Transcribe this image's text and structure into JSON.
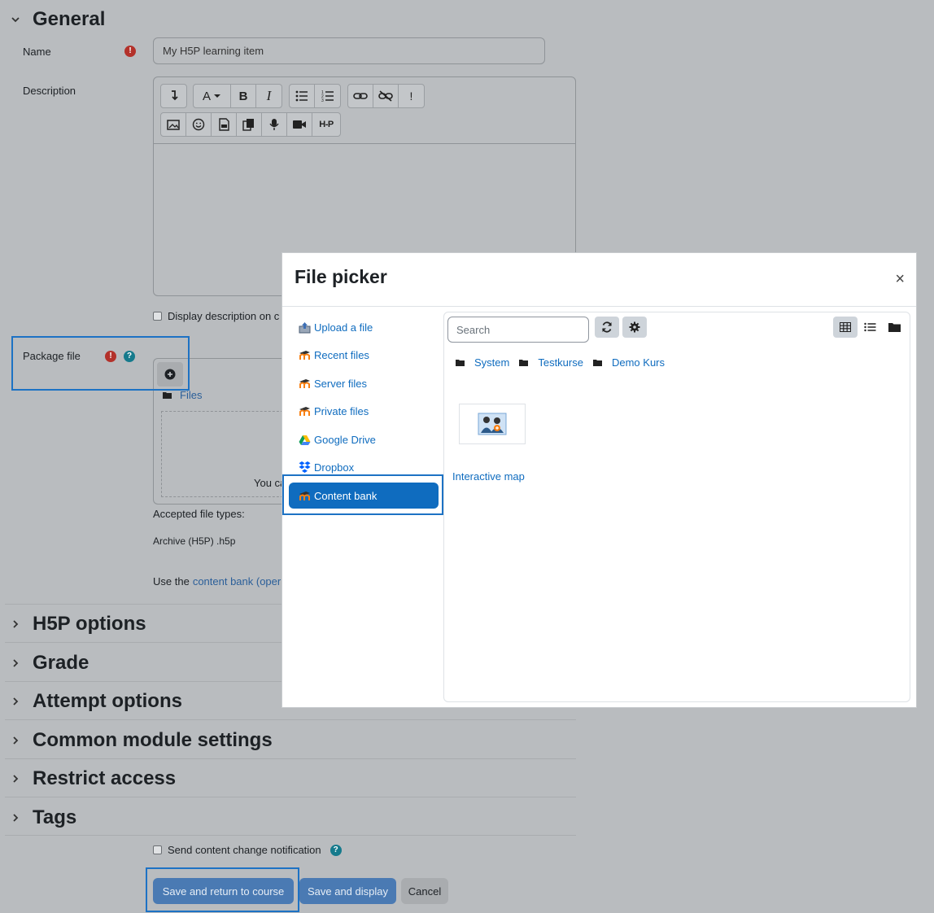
{
  "general": {
    "title": "General",
    "name_label": "Name",
    "name_value": "My H5P learning item",
    "description_label": "Description",
    "display_description_label": "Display description on c",
    "package_file_label": "Package file",
    "files_label": "Files",
    "drop_text_partial": "You ca",
    "accepted_types_label": "Accepted file types:",
    "accepted_type": "Archive (H5P) .h5p",
    "use_the": "Use the",
    "content_bank_link": "content bank (oper"
  },
  "editor_toolbar": {
    "row1": [
      "collapse-icon",
      "font-color-icon",
      "bold-icon",
      "italic-icon",
      "unordered-list-icon",
      "ordered-list-icon",
      "link-icon",
      "unlink-icon",
      "emoji-alert-icon"
    ],
    "row2": [
      "image-icon",
      "emoji-icon",
      "media-icon",
      "copy-icon",
      "microphone-icon",
      "video-icon",
      "h5p-icon"
    ],
    "h5p_label": "H-P",
    "font_label": "A",
    "bold_label": "B",
    "italic_label": "I",
    "exclaim_label": "!"
  },
  "sections": [
    {
      "title": "H5P options"
    },
    {
      "title": "Grade"
    },
    {
      "title": "Attempt options"
    },
    {
      "title": "Common module settings"
    },
    {
      "title": "Restrict access"
    },
    {
      "title": "Tags"
    }
  ],
  "footer": {
    "notify_label": "Send content change notification",
    "save_return_label": "Save and return to course",
    "save_display_label": "Save and display",
    "cancel_label": "Cancel"
  },
  "file_picker": {
    "title": "File picker",
    "close_label": "×",
    "repositories": [
      {
        "label": "Upload a file",
        "icon": "upload-icon"
      },
      {
        "label": "Recent files",
        "icon": "moodle-icon"
      },
      {
        "label": "Server files",
        "icon": "moodle-icon"
      },
      {
        "label": "Private files",
        "icon": "moodle-icon"
      },
      {
        "label": "Google Drive",
        "icon": "google-drive-icon"
      },
      {
        "label": "Dropbox",
        "icon": "dropbox-icon"
      },
      {
        "label": "Content bank",
        "icon": "moodle-icon",
        "active": true
      }
    ],
    "search_placeholder": "Search",
    "breadcrumbs": [
      "System",
      "Testkurse",
      "Demo Kurs"
    ],
    "files": [
      {
        "label": "Interactive map"
      }
    ]
  },
  "colors": {
    "accent": "#0f6cbf",
    "overlay": "#b9bcbf",
    "required": "#b3312a",
    "help": "#157a8c"
  }
}
